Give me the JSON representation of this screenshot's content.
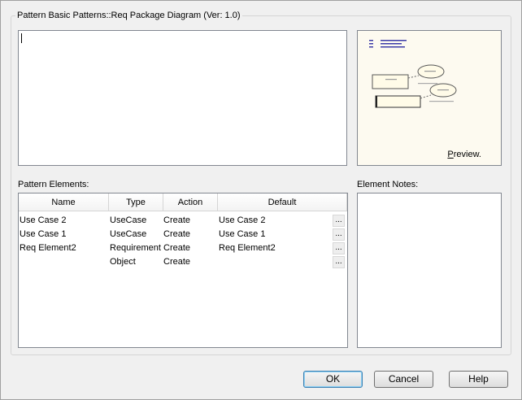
{
  "window": {
    "group_title": "Pattern Basic Patterns::Req Package Diagram (Ver: 1.0)"
  },
  "description": {
    "value": ""
  },
  "preview": {
    "label_hotkey": "P",
    "label_rest": "review."
  },
  "elements": {
    "label": "Pattern Elements:",
    "columns": [
      "Name",
      "Type",
      "Action",
      "Default"
    ],
    "rows": [
      {
        "name": "Use Case 2",
        "type": "UseCase",
        "action": "Create",
        "default": "Use Case 2",
        "more": "..."
      },
      {
        "name": "Use Case 1",
        "type": "UseCase",
        "action": "Create",
        "default": "Use Case 1",
        "more": "..."
      },
      {
        "name": "Req Element2",
        "type": "Requirement",
        "action": "Create",
        "default": "Req Element2",
        "more": "..."
      },
      {
        "name": "",
        "type": "Object",
        "action": "Create",
        "default": "",
        "more": "..."
      }
    ]
  },
  "notes": {
    "label": "Element Notes:"
  },
  "buttons": {
    "ok": "OK",
    "cancel": "Cancel",
    "help": "Help"
  }
}
